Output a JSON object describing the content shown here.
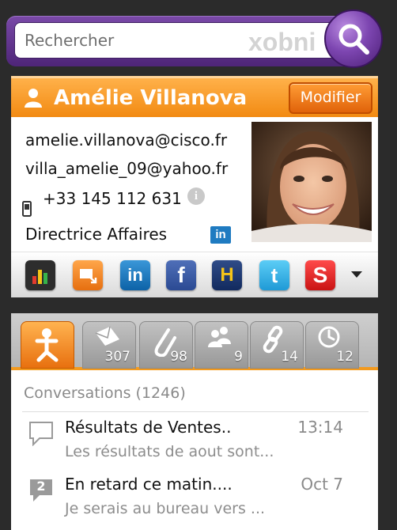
{
  "search": {
    "placeholder": "Rechercher",
    "brand": "xobni"
  },
  "contact": {
    "name": "Amélie Villanova",
    "edit_label": "Modifier",
    "email_primary": "amelie.villanova@cisco.fr",
    "email_secondary": "villa_amelie_09@yahoo.fr",
    "phone": "+33 145 112 631",
    "title": "Directrice Affaires",
    "linkedin_badge": "in",
    "header_color": "#f28a12"
  },
  "social": [
    {
      "name": "analytics",
      "icon": "bar-chart-icon"
    },
    {
      "name": "xobni-share",
      "icon": "share-icon"
    },
    {
      "name": "linkedin",
      "icon": "linkedin-icon",
      "label": "in"
    },
    {
      "name": "facebook",
      "icon": "facebook-icon",
      "label": "f"
    },
    {
      "name": "hoovers",
      "icon": "hoovers-icon",
      "label": "H"
    },
    {
      "name": "twitter",
      "icon": "twitter-icon",
      "label": "t"
    },
    {
      "name": "salesforce",
      "icon": "salesforce-icon",
      "label": "S"
    }
  ],
  "tabs": [
    {
      "name": "people-hub",
      "icon": "person-icon",
      "count": ""
    },
    {
      "name": "emails",
      "icon": "envelope-icon",
      "count": "307"
    },
    {
      "name": "attachments",
      "icon": "paperclip-icon",
      "count": "98"
    },
    {
      "name": "contacts",
      "icon": "people-icon",
      "count": "9"
    },
    {
      "name": "links",
      "icon": "link-icon",
      "count": "14"
    },
    {
      "name": "appointments",
      "icon": "clock-icon",
      "count": "12"
    }
  ],
  "conversations": {
    "title": "Conversations (1246)",
    "items": [
      {
        "subject": "Résultats de Ventes..",
        "time": "13:14",
        "preview": "Les résultats de aout sont...",
        "badge": ""
      },
      {
        "subject": "En retard ce matin....",
        "time": "Oct 7",
        "preview": "Je serais au bureau vers ...",
        "badge": "2"
      }
    ]
  }
}
